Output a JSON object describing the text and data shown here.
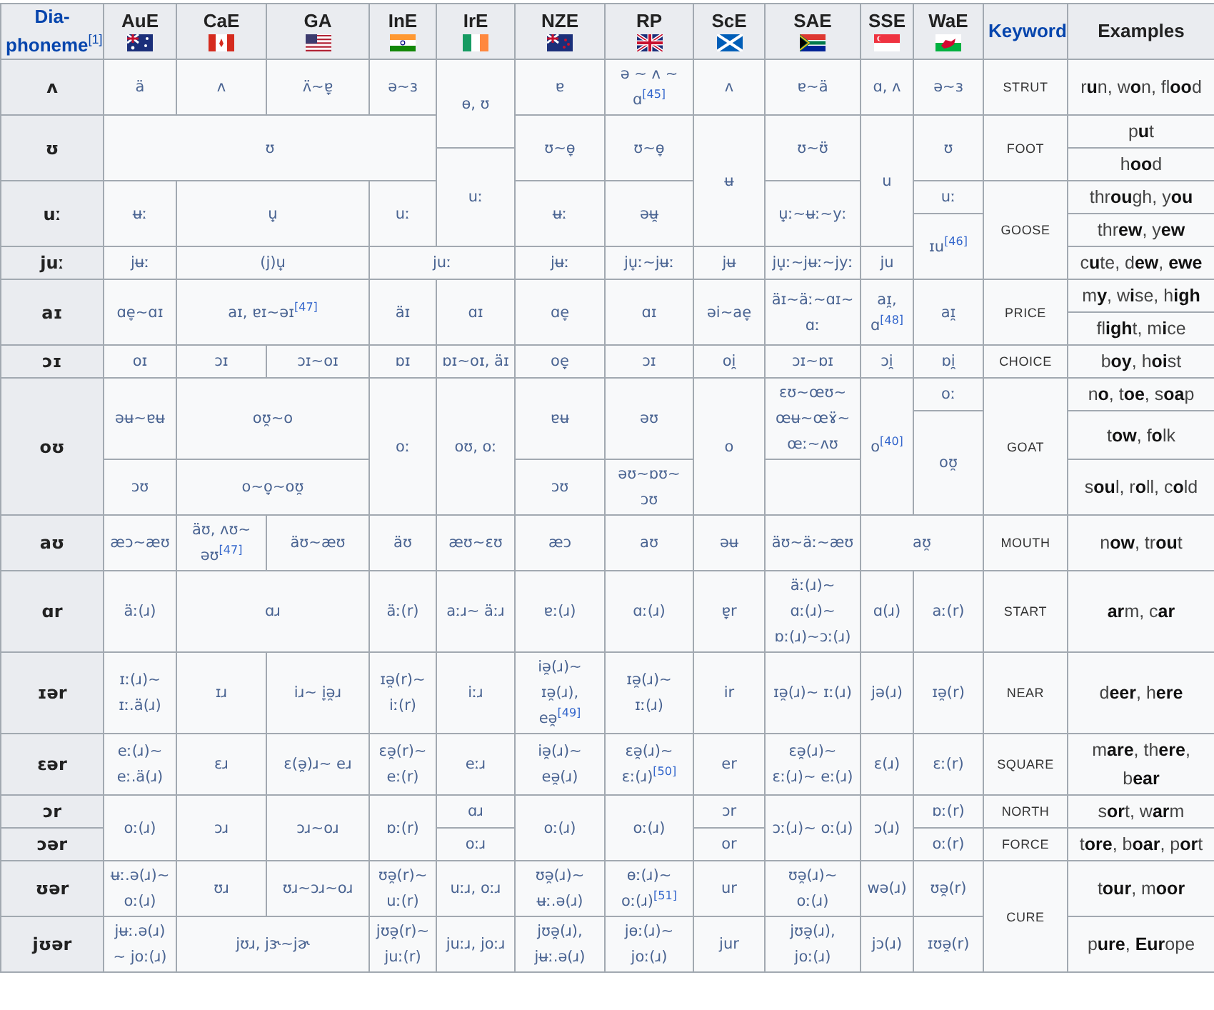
{
  "table": {
    "columns": [
      {
        "label": "Dia-phoneme$^{[1]}$",
        "flag": false,
        "link": true
      },
      {
        "label": "AuE",
        "flag": true,
        "link": false
      },
      {
        "label": "CaE",
        "flag": true,
        "link": false
      },
      {
        "label": "GA",
        "flag": true,
        "link": false
      },
      {
        "label": "InE",
        "flag": true,
        "link": false
      },
      {
        "label": "IrE",
        "flag": true,
        "link": false
      },
      {
        "label": "NZE",
        "flag": true,
        "link": false
      },
      {
        "label": "RP",
        "flag": true,
        "link": false
      },
      {
        "label": "ScE",
        "flag": true,
        "link": false
      },
      {
        "label": "SAE",
        "flag": true,
        "link": false
      },
      {
        "label": "SSE",
        "flag": true,
        "link": false
      },
      {
        "label": "WaE",
        "flag": true,
        "link": false
      },
      {
        "label": "Keyword",
        "flag": false,
        "link": true
      },
      {
        "label": "Examples",
        "flag": false,
        "link": false
      }
    ],
    "rows": [
      {
        "phoneme": {
          "text": "ʌ"
        },
        "variants": [
          {
            "text": "ä"
          },
          {
            "text": "ʌ"
          },
          {
            "text": "ʌ̈~ɐ̞"
          },
          {
            "text": "ə~ɜ"
          },
          {
            "text": "ɵ, ʊ",
            "rowspan": 2
          },
          {
            "text": "ɐ"
          },
          {
            "text": "ə ~ ʌ ~ ɑ$^{[45]}$"
          },
          {
            "text": "ʌ"
          },
          {
            "text": "ɐ~ä"
          },
          {
            "text": "ɑ, ʌ"
          },
          {
            "text": "ə~ɜ"
          }
        ],
        "keyword": {
          "text": "STRUT"
        },
        "example": "r**u**n, w**o**n, fl**oo**d"
      },
      {
        "phoneme": {
          "text": "ʊ",
          "rowspan": 2
        },
        "variants": [
          {
            "text": "ʊ",
            "colspan": 4,
            "rowspan": 2
          },
          {
            "text": "ʊ~ɵ̞",
            "rowspan": 2
          },
          {
            "text": "ʊ~ɵ̞",
            "rowspan": 2
          },
          {
            "text": "ʉ",
            "rowspan": 4
          },
          {
            "text": "ʊ~ʊ̈",
            "rowspan": 2
          },
          {
            "text": "u",
            "rowspan": 4
          },
          {
            "text": "ʊ",
            "rowspan": 2
          }
        ],
        "keyword": {
          "text": "FOOT",
          "rowspan": 2
        },
        "example": "p**u**t"
      },
      {
        "variants": [
          {
            "text": "uː",
            "rowspan": 3
          }
        ],
        "example": "h**oo**d"
      },
      {
        "phoneme": {
          "text": "uː",
          "rowspan": 2
        },
        "variants": [
          {
            "text": "ʉː",
            "rowspan": 2
          },
          {
            "text": "u̟",
            "colspan": 2,
            "rowspan": 2
          },
          {
            "text": "uː",
            "rowspan": 2
          },
          {
            "text": "ʉː",
            "rowspan": 2
          },
          {
            "text": "əʉ̯",
            "rowspan": 2
          },
          {
            "text": "u̟ː~ʉː~yː",
            "rowspan": 2
          },
          {
            "text": "uː"
          }
        ],
        "keyword": {
          "text": "GOOSE",
          "rowspan": 3
        },
        "example": "thr**ou**gh, y**ou**"
      },
      {
        "variants": [
          {
            "text": "ɪu$^{[46]}$",
            "rowspan": 2
          }
        ],
        "example": "thr**ew**, y**ew**"
      },
      {
        "phoneme": {
          "text": "juː"
        },
        "variants": [
          {
            "text": "jʉː"
          },
          {
            "text": "(j)u̟",
            "colspan": 2
          },
          {
            "text": "juː",
            "colspan": 2
          },
          {
            "text": "jʉː"
          },
          {
            "text": "ju̟ː~jʉː"
          },
          {
            "text": "jʉ"
          },
          {
            "text": "ju̟ː~jʉː~jyː"
          },
          {
            "text": "ju"
          }
        ],
        "example": "c**u**te, d**ew**, **ewe**"
      },
      {
        "phoneme": {
          "text": "aɪ",
          "rowspan": 2
        },
        "variants": [
          {
            "text": "ɑe̞~ɑɪ",
            "rowspan": 2
          },
          {
            "text": "aɪ, ɐɪ~əɪ$^{[47]}$",
            "colspan": 2,
            "rowspan": 2
          },
          {
            "text": "äɪ",
            "rowspan": 2
          },
          {
            "text": "ɑɪ",
            "rowspan": 2
          },
          {
            "text": "ɑe̞",
            "rowspan": 2
          },
          {
            "text": "ɑɪ",
            "rowspan": 2
          },
          {
            "text": "əi~ae̞",
            "rowspan": 2
          },
          {
            "text": "äɪ~äː~ɑɪ~ɑː",
            "rowspan": 2
          },
          {
            "text": "aɪ̯, ɑ$^{[48]}$",
            "rowspan": 2
          },
          {
            "text": "aɪ̯",
            "rowspan": 2
          }
        ],
        "keyword": {
          "text": "PRICE",
          "rowspan": 2
        },
        "example": "m**y**, w**i**se, h**igh**"
      },
      {
        "variants": [],
        "example": "fl**igh**t, m**i**ce"
      },
      {
        "phoneme": {
          "text": "ɔɪ"
        },
        "variants": [
          {
            "text": "oɪ"
          },
          {
            "text": "ɔɪ"
          },
          {
            "text": "ɔɪ~oɪ"
          },
          {
            "text": "ɒɪ"
          },
          {
            "text": "ɒɪ~oɪ, äɪ"
          },
          {
            "text": "oe̞"
          },
          {
            "text": "ɔɪ"
          },
          {
            "text": "oi̯"
          },
          {
            "text": "ɔɪ~ɒɪ"
          },
          {
            "text": "ɔi̯"
          },
          {
            "text": "ɒi̯"
          }
        ],
        "keyword": {
          "text": "CHOICE"
        },
        "example": "b**oy**, h**oi**st"
      },
      {
        "phoneme": {
          "text": "oʊ",
          "rowspan": 3
        },
        "variants": [
          {
            "text": "əʉ~ɐʉ",
            "rowspan": 2
          },
          {
            "text": "oʊ̯~o",
            "colspan": 2,
            "rowspan": 2
          },
          {
            "text": "oː",
            "rowspan": 3
          },
          {
            "text": "oʊ, oː",
            "rowspan": 3
          },
          {
            "text": "ɐʉ",
            "rowspan": 2
          },
          {
            "text": "əʊ",
            "rowspan": 2
          },
          {
            "text": "o",
            "rowspan": 3
          },
          {
            "text": "ɛʊ~œʊ~œʉ~œɤ̈~œː~ʌʊ",
            "rowspan": 2
          },
          {
            "text": "o$^{[40]}$",
            "rowspan": 3
          },
          {
            "text": "oː"
          }
        ],
        "keyword": {
          "text": "GOAT",
          "rowspan": 3
        },
        "example": "n**o**, t**oe**, s**oa**p"
      },
      {
        "variants": [
          {
            "text": "oʊ̯",
            "rowspan": 2
          }
        ],
        "example": "t**ow**, f**o**lk"
      },
      {
        "variants": [
          {
            "text": "ɔʊ"
          },
          {
            "text": "o~o̞~oʊ̯",
            "colspan": 2
          },
          {
            "text": "ɔʊ"
          },
          {
            "text": "əʊ~ɒʊ~ɔʊ"
          },
          {
            "blank": true
          }
        ],
        "example": "s**ou**l, r**o**ll, c**o**ld"
      },
      {
        "phoneme": {
          "text": "aʊ"
        },
        "variants": [
          {
            "text": "æɔ~æʊ"
          },
          {
            "text": "äʊ, ʌʊ~əʊ$^{[47]}$"
          },
          {
            "text": "äʊ~æʊ"
          },
          {
            "text": "äʊ"
          },
          {
            "text": "æʊ~ɛʊ"
          },
          {
            "text": "æɔ"
          },
          {
            "text": "aʊ"
          },
          {
            "text": "əʉ"
          },
          {
            "text": "äʊ~äː~æʊ"
          },
          {
            "text": "aʊ̯",
            "colspan": 2
          }
        ],
        "keyword": {
          "text": "MOUTH"
        },
        "example": "n**ow**, tr**ou**t"
      },
      {
        "phoneme": {
          "text": "ɑr"
        },
        "variants": [
          {
            "text": "äː(ɹ)"
          },
          {
            "text": "ɑɹ",
            "colspan": 2
          },
          {
            "text": "äː(r)"
          },
          {
            "text": "aːɹ~ äːɹ"
          },
          {
            "text": "ɐː(ɹ)"
          },
          {
            "text": "ɑː(ɹ)"
          },
          {
            "text": "ɐ̞r"
          },
          {
            "text": "äː(ɹ)~ɑː(ɹ)~ ɒː(ɹ)~ɔː(ɹ)"
          },
          {
            "text": "ɑ(ɹ)"
          },
          {
            "text": "aː(r)"
          }
        ],
        "keyword": {
          "text": "START"
        },
        "example": "**ar**m, c**ar**"
      },
      {
        "phoneme": {
          "text": "ɪər"
        },
        "variants": [
          {
            "text": "ɪː(ɹ)~ ɪː.ä(ɹ)"
          },
          {
            "text": "ɪɹ"
          },
          {
            "text": "iɹ~ i̞ə̯ɹ"
          },
          {
            "text": "ɪə̯(r)~ iː(r)"
          },
          {
            "text": "iːɹ"
          },
          {
            "text": "iə̯(ɹ)~ ɪə̯(ɹ), eə̯$^{[49]}$"
          },
          {
            "text": "ɪə̯(ɹ)~ ɪː(ɹ)"
          },
          {
            "text": "ir"
          },
          {
            "text": "ɪə̯(ɹ)~ ɪː(ɹ)"
          },
          {
            "text": "jə(ɹ)"
          },
          {
            "text": "ɪə̯(r)"
          }
        ],
        "keyword": {
          "text": "NEAR"
        },
        "example": "d**eer**, h**ere**"
      },
      {
        "phoneme": {
          "text": "ɛər"
        },
        "variants": [
          {
            "text": "eː(ɹ)~ eː.ä(ɹ)"
          },
          {
            "text": "ɛɹ"
          },
          {
            "text": "ɛ(ə̯)ɹ~ eɹ"
          },
          {
            "text": "ɛə̯(r)~ eː(r)"
          },
          {
            "text": "eːɹ"
          },
          {
            "text": "iə̯(ɹ)~ eə̯(ɹ)"
          },
          {
            "text": "ɛə̯(ɹ)~ ɛː(ɹ)$^{[50]}$"
          },
          {
            "text": "er"
          },
          {
            "text": "ɛə̯(ɹ)~ ɛː(ɹ)~ eː(ɹ)"
          },
          {
            "text": "ɛ(ɹ)"
          },
          {
            "text": "ɛː(r)"
          }
        ],
        "keyword": {
          "text": "SQUARE"
        },
        "example": "m**are**, th**ere**, b**ear**"
      },
      {
        "phoneme": {
          "text": "ɔr"
        },
        "variants": [
          {
            "text": "oː(ɹ)",
            "rowspan": 2
          },
          {
            "text": "ɔɹ",
            "rowspan": 2
          },
          {
            "text": "ɔɹ~oɹ",
            "rowspan": 2
          },
          {
            "text": "ɒː(r)",
            "rowspan": 2
          },
          {
            "text": "ɑɹ"
          },
          {
            "text": "oː(ɹ)",
            "rowspan": 2
          },
          {
            "text": "oː(ɹ)",
            "rowspan": 2
          },
          {
            "text": "ɔr"
          },
          {
            "text": "ɔː(ɹ)~ oː(ɹ)",
            "rowspan": 2
          },
          {
            "text": "ɔ(ɹ)",
            "rowspan": 2
          },
          {
            "text": "ɒː(r)"
          }
        ],
        "keyword": {
          "text": "NORTH"
        },
        "example": "s**or**t, w**ar**m"
      },
      {
        "phoneme": {
          "text": "ɔər"
        },
        "variants": [
          {
            "text": "oːɹ"
          },
          {
            "text": "or"
          },
          {
            "text": "oː(r)"
          }
        ],
        "keyword": {
          "text": "FORCE"
        },
        "example": "t**ore**, b**oar**, p**or**t"
      },
      {
        "phoneme": {
          "text": "ʊər"
        },
        "variants": [
          {
            "text": "ʉː.ə(ɹ)~ oː(ɹ)"
          },
          {
            "text": "ʊɹ"
          },
          {
            "text": "ʊɹ~ɔɹ~oɹ"
          },
          {
            "text": "ʊə̯(r)~ uː(r)"
          },
          {
            "text": "uːɹ, oːɹ"
          },
          {
            "text": "ʊə̯(ɹ)~ ʉː.ə(ɹ)"
          },
          {
            "text": "ɵː(ɹ)~ oː(ɹ)$^{[51]}$"
          },
          {
            "text": "ur"
          },
          {
            "text": "ʊə̯(ɹ)~ oː(ɹ)"
          },
          {
            "text": "wə(ɹ)"
          },
          {
            "text": "ʊə̯(r)"
          }
        ],
        "keyword": {
          "text": "CURE",
          "rowspan": 2
        },
        "example": "t**our**, m**oor**"
      },
      {
        "phoneme": {
          "text": "jʊər"
        },
        "variants": [
          {
            "text": "jʉː.ə(ɹ)~ joː(ɹ)"
          },
          {
            "text": "jʊɹ, jɝ~jɚ",
            "colspan": 2
          },
          {
            "text": "jʊə̯(r)~ juː(r)"
          },
          {
            "text": "juːɹ, joːɹ"
          },
          {
            "text": "jʊə̯(ɹ), jʉː.ə(ɹ)"
          },
          {
            "text": "jɵː(ɹ)~ joː(ɹ)"
          },
          {
            "text": "jur"
          },
          {
            "text": "jʊə̯(ɹ), joː(ɹ)"
          },
          {
            "text": "jɔ(ɹ)"
          },
          {
            "text": "ɪʊə̯(r)"
          }
        ],
        "example": "p**ure**, **Eur**ope"
      }
    ]
  }
}
